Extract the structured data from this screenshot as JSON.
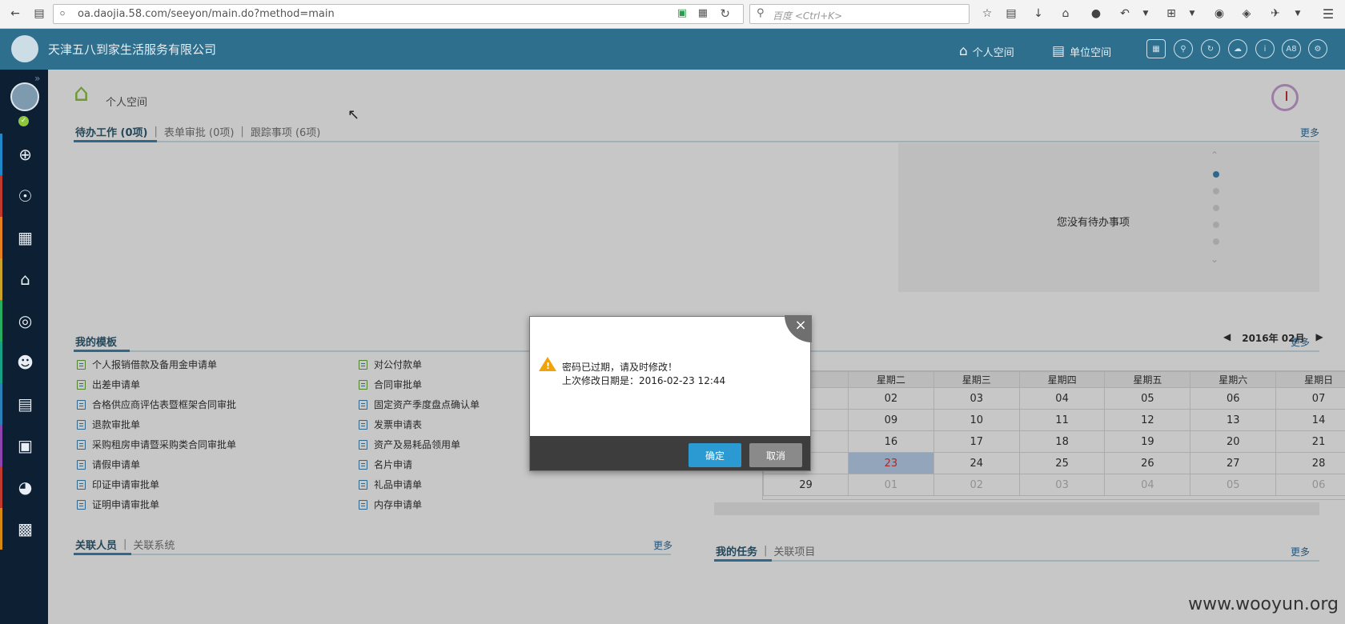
{
  "browser": {
    "url": "oa.daojia.58.com/seeyon/main.do?method=main",
    "search_placeholder": "百度 <Ctrl+K>"
  },
  "header": {
    "company": "天津五八到家生活服务有限公司",
    "nav_personal": "个人空间",
    "nav_unit": "单位空间",
    "icon_a8": "A8"
  },
  "page": {
    "title": "个人空间"
  },
  "todo": {
    "tabs": [
      "待办工作 (0项)",
      "表单审批 (0项)",
      "跟踪事项 (6项)"
    ],
    "more": "更多",
    "empty": "您没有待办事项"
  },
  "templates": {
    "title": "我的模板",
    "more": "更多",
    "col1": [
      "个人报销借款及备用金申请单",
      "出差申请单",
      "合格供应商评估表暨框架合同审批",
      "退款审批单",
      "采购租房申请暨采购类合同审批单",
      "请假申请单",
      "印证申请审批单",
      "证明申请审批单"
    ],
    "col2": [
      "对公付款单",
      "合同审批单",
      "固定资产季度盘点确认单",
      "发票申请表",
      "资产及易耗品领用单",
      "名片申请",
      "礼品申请单",
      "内存申请单"
    ]
  },
  "calendar": {
    "more": "更多",
    "month": "2016年 02月",
    "weekdays": [
      "星期二",
      "星期三",
      "星期四",
      "星期五",
      "星期六",
      "星期日"
    ],
    "rows": [
      [
        "02",
        "03",
        "04",
        "05",
        "06",
        "07"
      ],
      [
        "09",
        "10",
        "11",
        "12",
        "13",
        "14"
      ],
      [
        "16",
        "17",
        "18",
        "19",
        "20",
        "21"
      ],
      [
        "23",
        "24",
        "25",
        "26",
        "27",
        "28"
      ],
      [
        "01",
        "02",
        "03",
        "04",
        "05",
        "06"
      ]
    ],
    "first_col_last": "29"
  },
  "related": {
    "tabs": [
      "关联人员",
      "关联系统"
    ],
    "more": "更多"
  },
  "tasks": {
    "tabs": [
      "我的任务",
      "关联项目"
    ],
    "more": "更多"
  },
  "dialog": {
    "message": "密码已过期，请及时修改！",
    "last_modified": "上次修改日期是：2016-02-23 12:44",
    "ok": "确定",
    "cancel": "取消"
  },
  "watermark": "www.wooyun.org"
}
